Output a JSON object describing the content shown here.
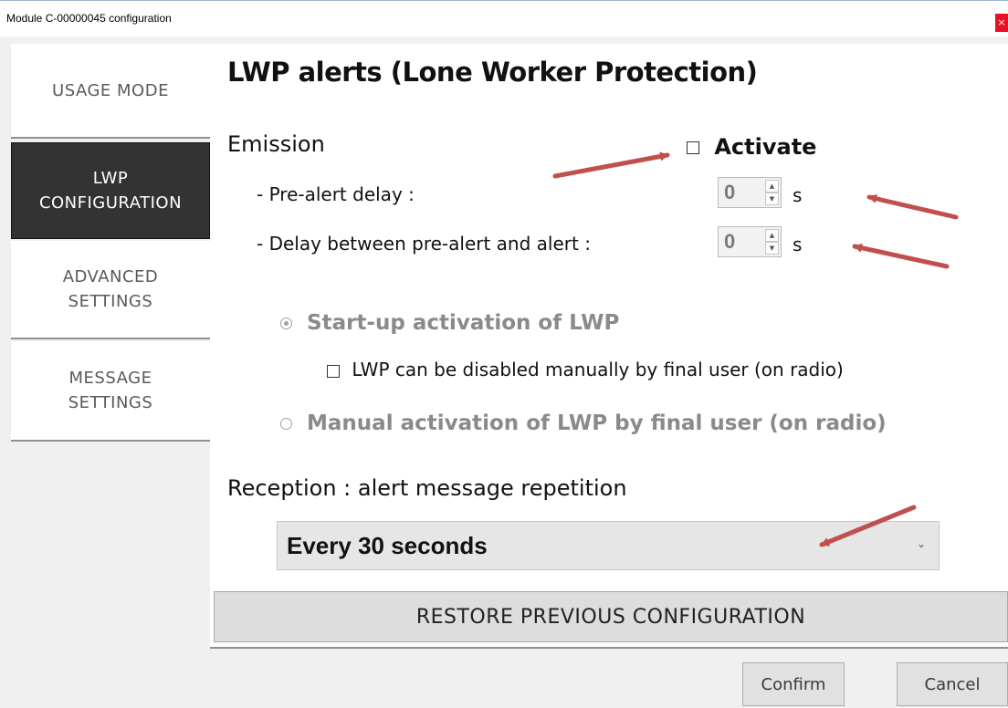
{
  "window": {
    "title": "Module C-00000045 configuration",
    "close_label": "×"
  },
  "nav": {
    "items": [
      {
        "label": "USAGE MODE"
      },
      {
        "label": "LWP\nCONFIGURATION"
      },
      {
        "label": "ADVANCED\nSETTINGS"
      },
      {
        "label": "MESSAGE\nSETTINGS"
      }
    ]
  },
  "main": {
    "title": "LWP alerts (Lone Worker Protection)",
    "emission_label": "Emission",
    "activate_label": "Activate",
    "pre_alert": {
      "label": "- Pre-alert delay :",
      "value": "0",
      "unit": "s"
    },
    "delay_between": {
      "label": "- Delay between pre-alert and alert :",
      "value": "0",
      "unit": "s"
    },
    "startup_label": "Start-up activation of LWP",
    "disable_label": "LWP can be disabled manually by final user (on radio)",
    "manual_label": "Manual activation of LWP by final user (on radio)",
    "reception_label": "Reception : alert message repetition",
    "repetition_value": "Every 30 seconds",
    "restore_label": "RESTORE PREVIOUS CONFIGURATION"
  },
  "footer": {
    "confirm_label": "Confirm",
    "cancel_label": "Cancel"
  },
  "colors": {
    "annotation_arrow": "#c0504d",
    "nav_active_bg": "#333333"
  },
  "icons": {
    "spin_up": "▲",
    "spin_down": "▼",
    "dropdown": "⌄"
  }
}
